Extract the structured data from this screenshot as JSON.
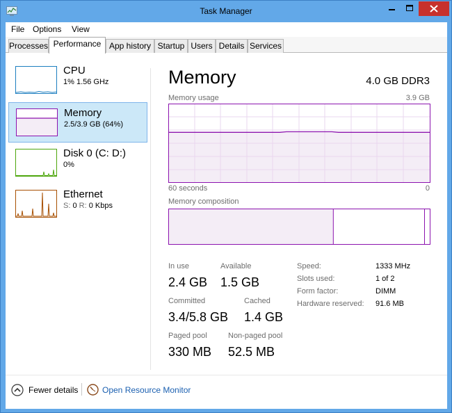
{
  "window": {
    "title": "Task Manager"
  },
  "menu": [
    "File",
    "Options",
    "View"
  ],
  "tabs": [
    "Processes",
    "Performance",
    "App history",
    "Startup",
    "Users",
    "Details",
    "Services"
  ],
  "active_tab": "Performance",
  "resources": [
    {
      "title": "CPU",
      "sub": "1% 1.56 GHz",
      "color": "#1c7ec0"
    },
    {
      "title": "Memory",
      "sub": "2.5/3.9 GB (64%)",
      "color": "#8b12ae",
      "selected": true
    },
    {
      "title": "Disk 0 (C: D:)",
      "sub": "0%",
      "color": "#4da60c"
    },
    {
      "title": "Ethernet",
      "sub_s_key": "S:",
      "sub_s_val": "0",
      "sub_r_key": "R:",
      "sub_r_val": "0 Kbps",
      "color": "#a74f01"
    }
  ],
  "memory": {
    "title": "Memory",
    "spec": "4.0 GB DDR3",
    "usage_label": "Memory usage",
    "usage_max": "3.9 GB",
    "time_left": "60 seconds",
    "time_right": "0",
    "usage_fraction": 0.64,
    "composition_label": "Memory composition",
    "composition_in_use_fraction": 0.63,
    "composition_standby_fraction": 0.35,
    "stats": {
      "in_use_label": "In use",
      "in_use": "2.4 GB",
      "available_label": "Available",
      "available": "1.5 GB",
      "committed_label": "Committed",
      "committed": "3.4/5.8 GB",
      "cached_label": "Cached",
      "cached": "1.4 GB",
      "paged_label": "Paged pool",
      "paged": "330 MB",
      "nonpaged_label": "Non-paged pool",
      "nonpaged": "52.5 MB"
    },
    "details": [
      {
        "label": "Speed:",
        "value": "1333 MHz"
      },
      {
        "label": "Slots used:",
        "value": "1 of 2"
      },
      {
        "label": "Form factor:",
        "value": "DIMM"
      },
      {
        "label": "Hardware reserved:",
        "value": "91.6 MB"
      }
    ]
  },
  "footer": {
    "fewer_details": "Fewer details",
    "open_resource_monitor": "Open Resource Monitor"
  },
  "colors": {
    "memory_accent": "#8b12ae",
    "memory_fill": "#f4edf6",
    "grid": "#ead7ef",
    "link": "#1a5fb0"
  }
}
